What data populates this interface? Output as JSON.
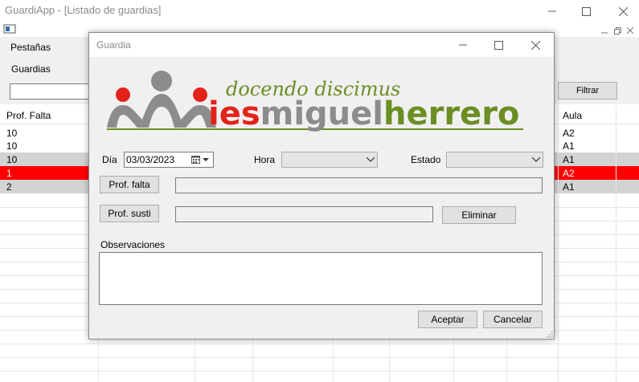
{
  "app": {
    "title": "GuardiApp - [Listado de guardias]"
  },
  "menubar": {
    "item": "Pestañas"
  },
  "tab": {
    "label": "Guardias"
  },
  "toolbar": {
    "filter_label": "Filtrar",
    "search_value": ""
  },
  "grid": {
    "headers": {
      "prof_falta": "Prof. Falta",
      "aula": "Aula"
    },
    "rows": [
      {
        "prof_falta": "10",
        "aula": "A2",
        "state": "normal"
      },
      {
        "prof_falta": "10",
        "aula": "A1",
        "state": "normal"
      },
      {
        "prof_falta": "10",
        "aula": "A1",
        "state": "gray"
      },
      {
        "prof_falta": "1",
        "aula": "A2",
        "state": "red"
      },
      {
        "prof_falta": "2",
        "aula": "A1",
        "state": "gray"
      }
    ]
  },
  "dialog": {
    "title": "Guardia",
    "logo": {
      "motto": "docendo discimus",
      "name_prefix": "ies",
      "name_middle": "miguel",
      "name_suffix": "herrero",
      "colors": {
        "red": "#e2231a",
        "gray": "#8c8c8c",
        "green": "#6b8e23"
      }
    },
    "dia_label": "Día",
    "dia_value": "03/03/2023",
    "hora_label": "Hora",
    "hora_value": "",
    "estado_label": "Estado",
    "estado_value": "",
    "prof_falta_button": "Prof. falta",
    "prof_falta_value": "",
    "prof_susti_button": "Prof. susti",
    "prof_susti_value": "",
    "eliminar_label": "Eliminar",
    "observaciones_label": "Observaciones",
    "observaciones_value": "",
    "aceptar_label": "Aceptar",
    "cancelar_label": "Cancelar"
  },
  "colors": {
    "row_red": "#ff0000",
    "row_gray": "#d3d3d3"
  },
  "icons": [
    "minimize-icon",
    "maximize-icon",
    "close-icon",
    "calendar-icon",
    "chevron-down-icon",
    "resize-grip-icon",
    "mdi-document-icon"
  ]
}
